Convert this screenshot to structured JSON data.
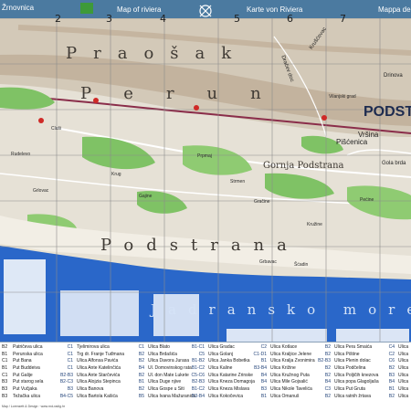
{
  "map": {
    "top_titles": [
      "Žrnovnica",
      "Map of riviera",
      "Karte von Riviera",
      "Mappa della"
    ],
    "grid_columns": [
      "2",
      "3",
      "4",
      "5",
      "6",
      "7"
    ],
    "regions": [
      "Praošak",
      "Perun",
      "Podstrana",
      "Jadransko more",
      "Gornja Podstrana"
    ],
    "places": [
      "Rudelevo",
      "Grlovac",
      "Gajine",
      "Krug",
      "Prpmaj",
      "Strmen",
      "Gračine",
      "Pećine",
      "Kružine",
      "Grbavac",
      "Šćadin",
      "Cluši",
      "Vilanjski grad"
    ],
    "roads": [
      "Vršina",
      "Pišćenica",
      "Dračev doc",
      "Krušćovac",
      "Drinova",
      "Gola brda"
    ],
    "logo": {
      "main": "PODST",
      "accent_letter": "O"
    },
    "colors": {
      "sea": "#2a67c9",
      "land": "#e6e1d6",
      "hills": "#d0c6b6",
      "green": "#7fc265",
      "ridge": "#8a2d4a",
      "header": "#4b7aa0"
    }
  },
  "index": {
    "columns": [
      [
        {
          "name": "Patričeva ulica",
          "code": "C1"
        },
        {
          "name": "Perunska ulica",
          "code": "C1"
        },
        {
          "name": "Put Bana",
          "code": "C1"
        },
        {
          "name": "Put Buddeiva",
          "code": "C1"
        },
        {
          "name": "Put Galije",
          "code": "B2-B3"
        },
        {
          "name": "Put starog sela",
          "code": "B2-C3"
        },
        {
          "name": "Put Vučjaka",
          "code": "B3"
        },
        {
          "name": "Težačka ulica",
          "code": "B4-C5"
        }
      ],
      [
        {
          "name": "Tjelimirova ulica",
          "code": "C1"
        },
        {
          "name": "Trg dr. Franje Tuđmana",
          "code": "B2"
        },
        {
          "name": "Ulica Alfonsa Pavića",
          "code": "B2"
        },
        {
          "name": "Ulica Ante Katelinčića",
          "code": "B4"
        },
        {
          "name": "Ulica Ante Starčevića",
          "code": "B2"
        },
        {
          "name": "Ulica Alojzia Stepinca",
          "code": "B1"
        },
        {
          "name": "Ulica Banova",
          "code": "B2"
        },
        {
          "name": "Ulica Bartola Kašića",
          "code": "B5"
        }
      ],
      [
        {
          "name": "Ulica Blato",
          "code": "B1-C1"
        },
        {
          "name": "Ulica Brdašića",
          "code": "C5"
        },
        {
          "name": "Ulica Davora Jurasa",
          "code": "B1-B2"
        },
        {
          "name": "Ul. Domovinskog rata",
          "code": "B1-C2"
        },
        {
          "name": "Ul. don Mate Lukete",
          "code": "C5-C6"
        },
        {
          "name": "Ulica Duge njive",
          "code": "B2-B3"
        },
        {
          "name": "Ulica Gospe u Siti",
          "code": "B1-C2"
        },
        {
          "name": "Ulica Ivana Mažuranića",
          "code": "B3-B4"
        }
      ],
      [
        {
          "name": "Ulica Gradac",
          "code": "C2"
        },
        {
          "name": "Ulica Golanj",
          "code": "C1-D1"
        },
        {
          "name": "Ulica Janka Bobetka",
          "code": "B1"
        },
        {
          "name": "Ulica Kaline",
          "code": "B3-B4"
        },
        {
          "name": "Ulica Katarine Zrinske",
          "code": "B4"
        },
        {
          "name": "Ulica Kneza Domagoja",
          "code": "B4"
        },
        {
          "name": "Ulica Kneza Mislava",
          "code": "B3"
        },
        {
          "name": "Ulica Kokočevica",
          "code": "B1"
        }
      ],
      [
        {
          "name": "Ulica Kotlace",
          "code": "B2"
        },
        {
          "name": "Ulica Kraljice Jelene",
          "code": "B2"
        },
        {
          "name": "Ulica Kralja Zvonimira",
          "code": "B2-B3"
        },
        {
          "name": "Ulica Križine",
          "code": "B2"
        },
        {
          "name": "Ulica Kružnog Puta",
          "code": "B2"
        },
        {
          "name": "Ulica Mile Gojsalić",
          "code": "B4"
        },
        {
          "name": "Ulica Nikole Tavelića",
          "code": "C3"
        },
        {
          "name": "Ulica Omanuš",
          "code": "B2"
        }
      ],
      [
        {
          "name": "Ulica Pera Smaića",
          "code": "C4"
        },
        {
          "name": "Ulica Pištine",
          "code": "C2"
        },
        {
          "name": "Ulica Plenin dolac",
          "code": "C6"
        },
        {
          "name": "Ulica Podčelina",
          "code": "B2"
        },
        {
          "name": "Ulica Poljičih knezova",
          "code": "B3"
        },
        {
          "name": "Ulica popa Glagoljaša",
          "code": "B4"
        },
        {
          "name": "Ulica Put Gruta",
          "code": "B1"
        },
        {
          "name": "Ulica ratnih žrtava",
          "code": "B2"
        }
      ],
      [
        {
          "name": "Ulica",
          "code": ""
        },
        {
          "name": "Ulica",
          "code": ""
        },
        {
          "name": "Ulica",
          "code": ""
        },
        {
          "name": "Ulica",
          "code": ""
        },
        {
          "name": "Ulica",
          "code": ""
        },
        {
          "name": "Ulica",
          "code": ""
        },
        {
          "name": "Ulica",
          "code": ""
        },
        {
          "name": "Ulica",
          "code": ""
        }
      ]
    ],
    "row_letters": [
      "B2",
      "B1",
      "C1",
      "B1",
      "C1",
      "B3",
      "B3",
      "B3"
    ]
  },
  "footer": "Map / Lorenzett & Design · www.rnd-radig.hr"
}
